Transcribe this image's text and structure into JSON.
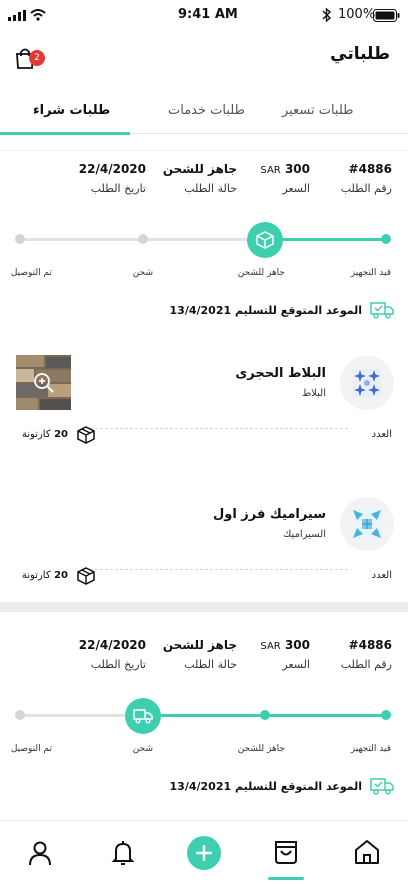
{
  "status_bar": {
    "time": "9:41 AM",
    "battery": "100%"
  },
  "header": {
    "title": "طلباتي",
    "cart_badge": "2"
  },
  "tabs": [
    {
      "label": "طلبات  شراء",
      "active": true
    },
    {
      "label": "طلبات خدمات",
      "active": false
    },
    {
      "label": "طلبات تسعير",
      "active": false
    }
  ],
  "orders": [
    {
      "order_number": "#4886",
      "order_number_label": "رقم الطلب",
      "price_unit": "SAR",
      "price_value": "300",
      "price_label": "السعر",
      "status_value": "جاهز للشحن",
      "status_label": "حالة الطلب",
      "date_value": "22/4/2020",
      "date_label": "تاريخ الطلب",
      "steps": [
        "قيد التجهيز",
        "جاهز للشحن",
        "شحن",
        "تم التوصيل"
      ],
      "current_step": 1,
      "current_icon": "box-icon",
      "delivery_label": "الموعد المتوقع للتسليم",
      "delivery_date": "13/4/2021",
      "products": [
        {
          "name": "البلاط الحجرى",
          "category": "البلاط",
          "qty_label": "العدد",
          "qty": "20",
          "qty_unit": "كارتونة",
          "has_preview": true
        },
        {
          "name": "سيراميك فرز اول",
          "category": "السيراميك",
          "qty_label": "العدد",
          "qty": "20",
          "qty_unit": "كارتونة",
          "has_preview": false
        }
      ]
    },
    {
      "order_number": "#4886",
      "order_number_label": "رقم الطلب",
      "price_unit": "SAR",
      "price_value": "300",
      "price_label": "السعر",
      "status_value": "جاهز للشحن",
      "status_label": "حالة الطلب",
      "date_value": "22/4/2020",
      "date_label": "تاريخ الطلب",
      "steps": [
        "قيد التجهيز",
        "جاهز للشحن",
        "شحن",
        "تم التوصيل"
      ],
      "current_step": 2,
      "current_icon": "truck-icon",
      "delivery_label": "الموعد المتوقع للتسليم",
      "delivery_date": "13/4/2021"
    }
  ],
  "bottom_nav": [
    {
      "name": "profile",
      "icon": "user-icon"
    },
    {
      "name": "notifications",
      "icon": "bell-icon"
    },
    {
      "name": "add",
      "icon": "plus-icon"
    },
    {
      "name": "orders",
      "icon": "bag-icon",
      "active": true
    },
    {
      "name": "home",
      "icon": "home-icon"
    }
  ],
  "colors": {
    "accent": "#3fcfb0",
    "badge": "#e53935",
    "inactive": "#d5d5d5"
  }
}
